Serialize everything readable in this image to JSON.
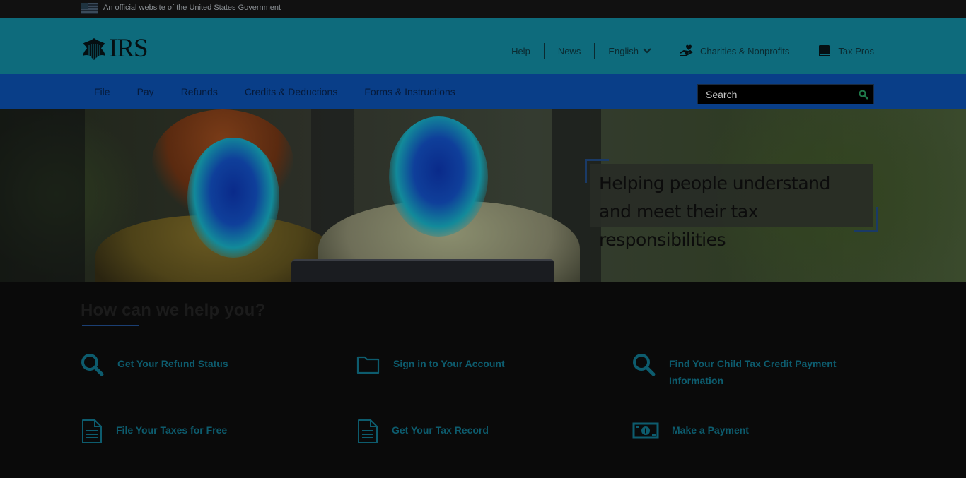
{
  "gov_banner": {
    "text": "An official website of the United States Government"
  },
  "header": {
    "logo_text": "IRS",
    "utility": {
      "help": "Help",
      "news": "News",
      "language": "English",
      "charities": "Charities & Nonprofits",
      "tax_pros": "Tax Pros"
    }
  },
  "nav": {
    "items": [
      "File",
      "Pay",
      "Refunds",
      "Credits & Deductions",
      "Forms & Instructions"
    ],
    "search_placeholder": "Search"
  },
  "hero": {
    "headline": "Helping people understand and meet their tax responsibilities"
  },
  "help": {
    "title": "How can we help you?",
    "tasks": [
      {
        "label": "Get Your Refund Status",
        "icon": "search-icon"
      },
      {
        "label": "Sign in to Your Account",
        "icon": "folder-icon"
      },
      {
        "label": "Find Your Child Tax Credit Payment Information",
        "icon": "search-icon"
      },
      {
        "label": "File Your Taxes for Free",
        "icon": "document-icon"
      },
      {
        "label": "Get Your Tax Record",
        "icon": "document-icon"
      },
      {
        "label": "Make a Payment",
        "icon": "money-icon"
      }
    ]
  },
  "colors": {
    "header_bg": "#0e6b7c",
    "nav_bg": "#093e88",
    "task_link": "#0d5c6e",
    "page_bg": "#0a0a0a"
  }
}
